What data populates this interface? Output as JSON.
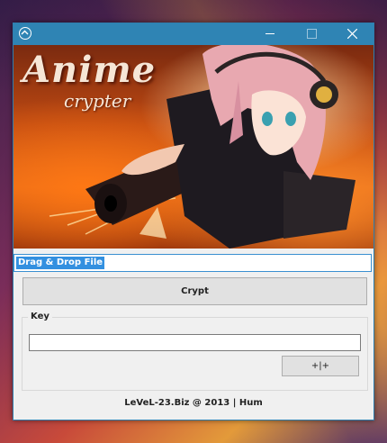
{
  "window": {
    "title": "",
    "app_icon": "circle-chevron-up-icon",
    "titlebar_color": "#2f84b4"
  },
  "banner": {
    "title": "Anime",
    "subtitle": "crypter"
  },
  "file": {
    "value": "Drag & Drop File"
  },
  "actions": {
    "crypt_label": "Crypt"
  },
  "key": {
    "group_label": "Key",
    "value": "",
    "generate_label": "+|+"
  },
  "footer": {
    "text": "LeVeL-23.Biz @ 2013 | Hum"
  }
}
